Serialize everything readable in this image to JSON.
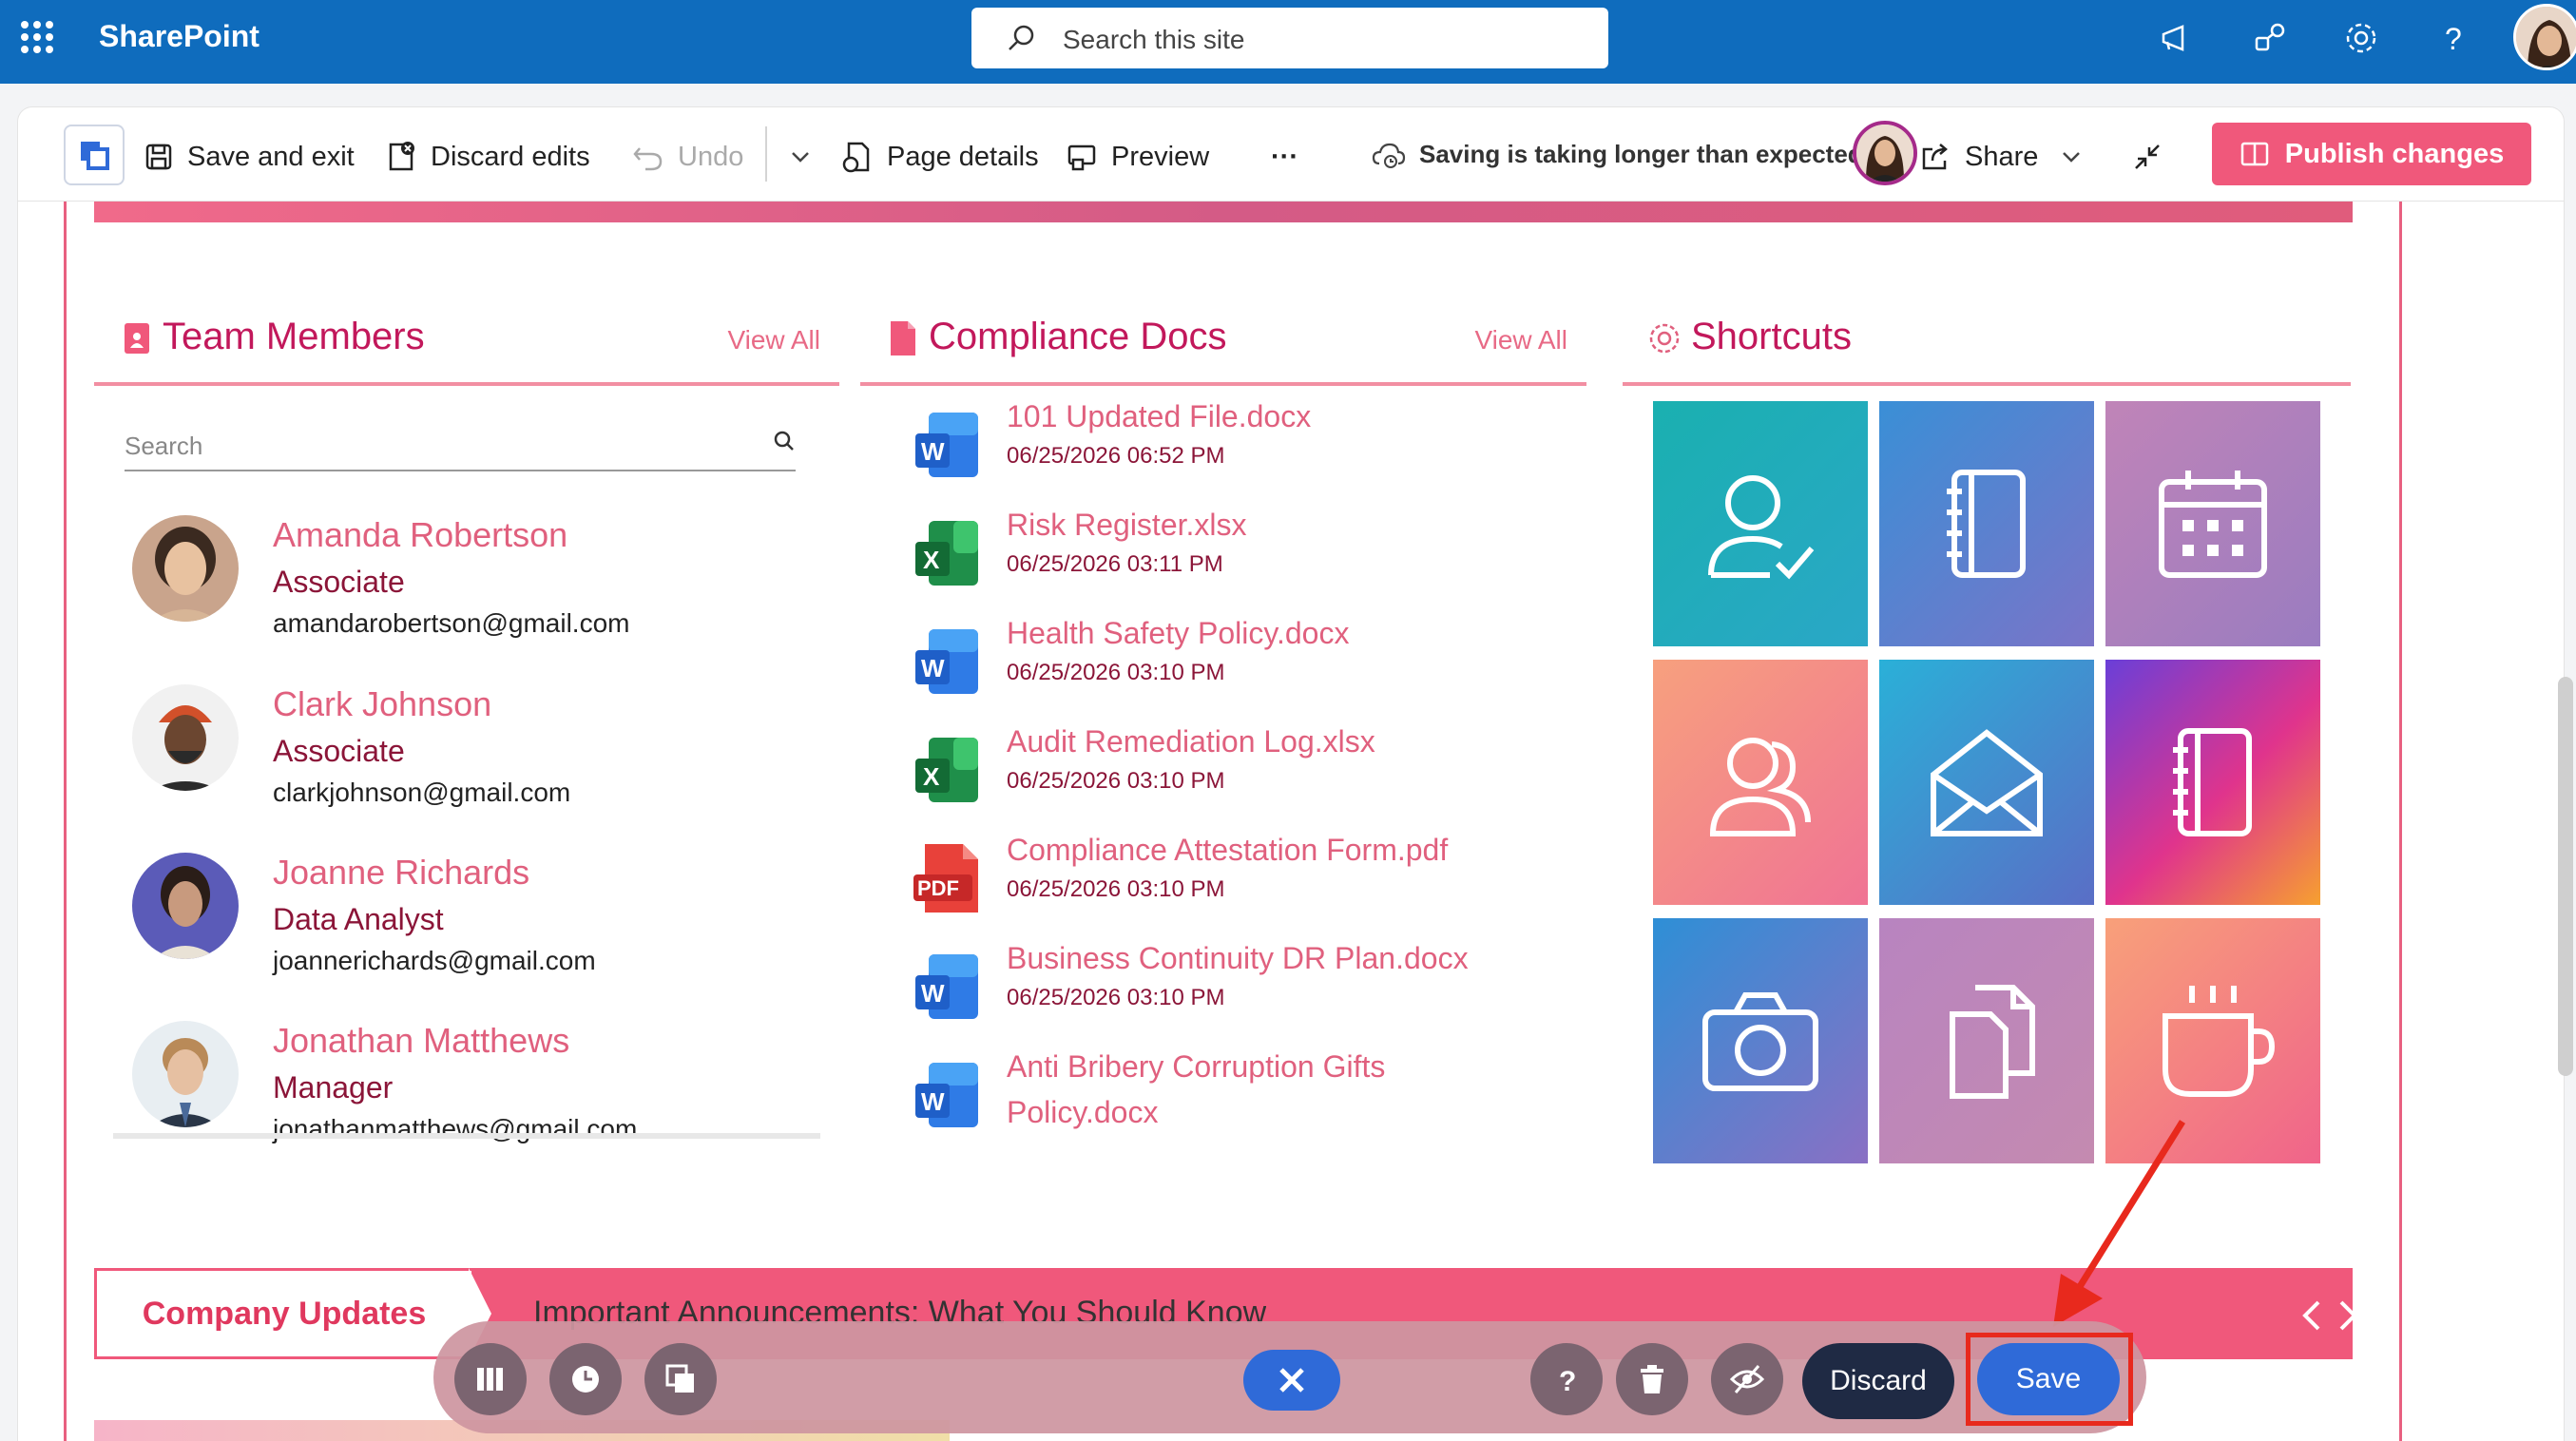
{
  "topbar": {
    "app_name": "SharePoint",
    "search_placeholder": "Search this site"
  },
  "commandbar": {
    "save_exit": "Save and exit",
    "discard_edits": "Discard edits",
    "undo": "Undo",
    "page_details": "Page details",
    "preview": "Preview",
    "more": "···",
    "saving_status": "Saving is taking longer than expected",
    "share": "Share",
    "publish": "Publish changes"
  },
  "team_members": {
    "title": "Team Members",
    "view_all": "View All",
    "search_placeholder": "Search",
    "members": [
      {
        "name": "Amanda Robertson",
        "role": "Associate",
        "email": "amandarobertson@gmail.com"
      },
      {
        "name": "Clark Johnson",
        "role": "Associate",
        "email": "clarkjohnson@gmail.com"
      },
      {
        "name": "Joanne Richards",
        "role": "Data Analyst",
        "email": "joannerichards@gmail.com"
      },
      {
        "name": "Jonathan Matthews",
        "role": "Manager",
        "email": "jonathanmatthews@gmail.com"
      }
    ]
  },
  "compliance_docs": {
    "title": "Compliance Docs",
    "view_all": "View All",
    "docs": [
      {
        "name": "101 Updated File.docx",
        "date": "06/25/2026 06:52 PM",
        "type": "word"
      },
      {
        "name": "Risk Register.xlsx",
        "date": "06/25/2026 03:11 PM",
        "type": "excel"
      },
      {
        "name": "Health Safety Policy.docx",
        "date": "06/25/2026 03:10 PM",
        "type": "word"
      },
      {
        "name": "Audit Remediation Log.xlsx",
        "date": "06/25/2026 03:10 PM",
        "type": "excel"
      },
      {
        "name": "Compliance Attestation Form.pdf",
        "date": "06/25/2026 03:10 PM",
        "type": "pdf"
      },
      {
        "name": "Business Continuity DR Plan.docx",
        "date": "06/25/2026 03:10 PM",
        "type": "word"
      },
      {
        "name": "Anti Bribery Corruption Gifts",
        "name_line2": "Policy.docx",
        "type": "word"
      }
    ]
  },
  "shortcuts": {
    "title": "Shortcuts",
    "tiles": [
      {
        "icon": "user-check-icon"
      },
      {
        "icon": "notebook-icon"
      },
      {
        "icon": "calendar-icon"
      },
      {
        "icon": "users-icon"
      },
      {
        "icon": "mail-open-icon"
      },
      {
        "icon": "notebook-icon"
      },
      {
        "icon": "camera-icon"
      },
      {
        "icon": "documents-icon"
      },
      {
        "icon": "coffee-icon"
      }
    ]
  },
  "company_updates": {
    "label": "Company Updates",
    "headline": "Important Announcements: What You Should Know"
  },
  "float_toolbar": {
    "discard": "Discard",
    "save": "Save"
  },
  "colors": {
    "brand_blue": "#0f6cbd",
    "accent_pink": "#f0587b",
    "highlight_red": "#e8291d"
  }
}
